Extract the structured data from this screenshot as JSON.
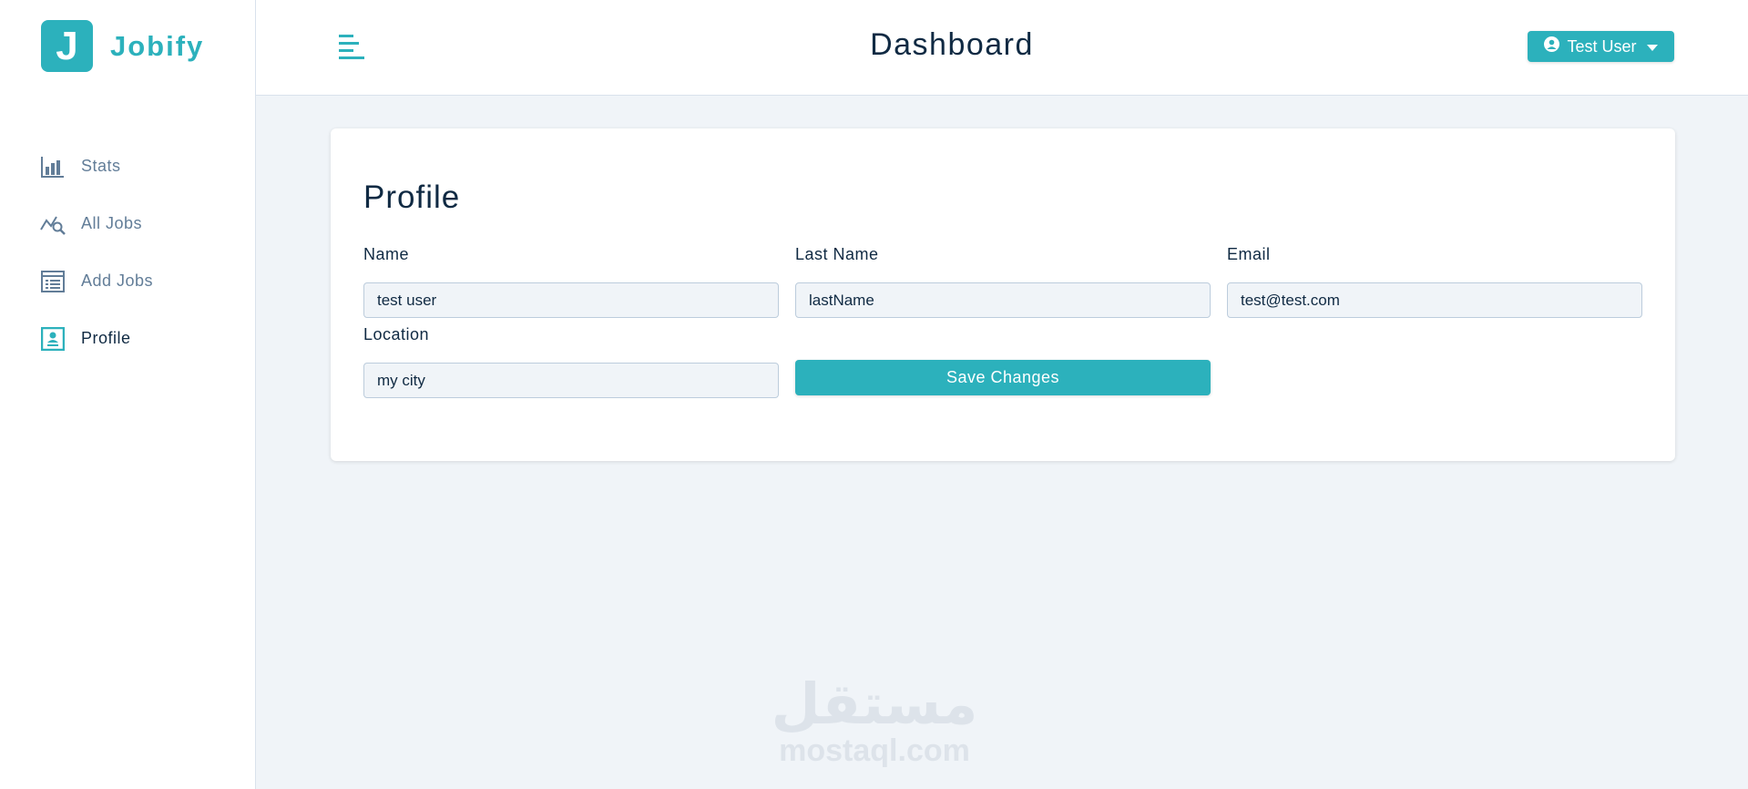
{
  "brand": {
    "mark": "J",
    "name": "Jobify",
    "accent": "#2cb1bc"
  },
  "header": {
    "title": "Dashboard",
    "user_label": "Test User"
  },
  "sidebar": {
    "items": [
      {
        "label": "Stats",
        "icon": "bar-chart-icon"
      },
      {
        "label": "All Jobs",
        "icon": "job-search-icon"
      },
      {
        "label": "Add Jobs",
        "icon": "form-list-icon"
      },
      {
        "label": "Profile",
        "icon": "profile-card-icon",
        "active": true
      }
    ]
  },
  "profile": {
    "title": "Profile",
    "fields": {
      "name": {
        "label": "Name",
        "value": "test user"
      },
      "last_name": {
        "label": "Last Name",
        "value": "lastName"
      },
      "email": {
        "label": "Email",
        "value": "test@test.com"
      },
      "location": {
        "label": "Location",
        "value": "my city"
      }
    },
    "save_label": "Save Changes"
  },
  "watermark": {
    "arabic": "مستقل",
    "latin": "mostaql.com"
  }
}
